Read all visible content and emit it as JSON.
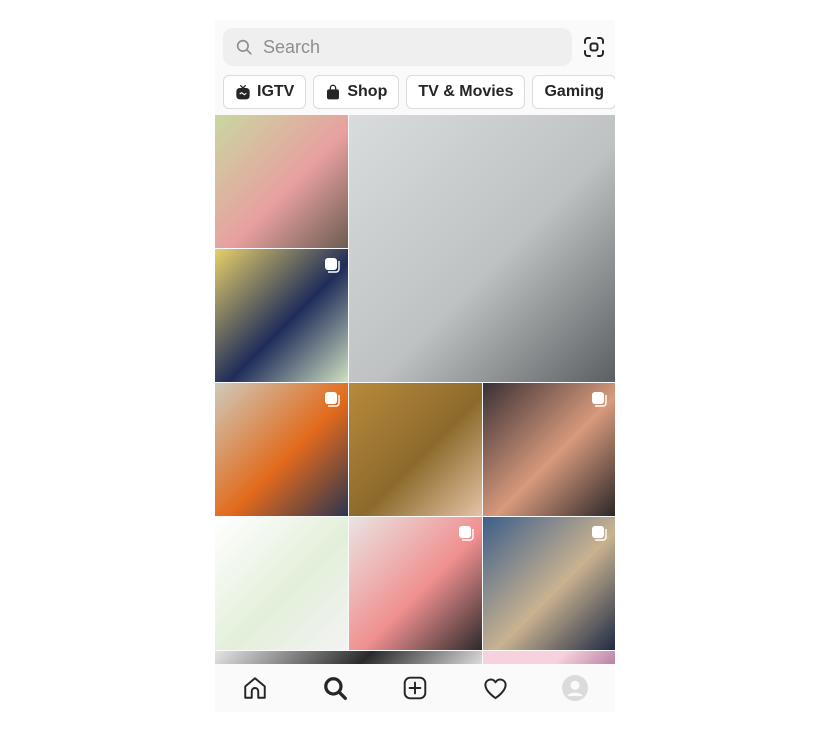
{
  "search": {
    "placeholder": "Search",
    "value": ""
  },
  "icons": {
    "search": "search-icon",
    "scan": "scan-icon",
    "igtv": "igtv-icon",
    "shop": "shopping-bag-icon",
    "home": "home-icon",
    "explore": "search-icon",
    "new_post": "plus-square-icon",
    "activity": "heart-icon",
    "profile": "avatar-icon",
    "carousel": "multiple-posts-icon"
  },
  "categories": [
    {
      "label": "IGTV",
      "icon": "igtv-icon"
    },
    {
      "label": "Shop",
      "icon": "shopping-bag-icon"
    },
    {
      "label": "TV & Movies",
      "icon": ""
    },
    {
      "label": "Gaming",
      "icon": ""
    },
    {
      "label": "",
      "icon": ""
    }
  ],
  "grid": {
    "tiles": [
      {
        "name": "anime-girl-blossoms-post",
        "carousel": false,
        "colors": [
          "#c9d7a0",
          "#e8a0a0",
          "#6b5d52"
        ]
      },
      {
        "name": "eye-drawing-video-post",
        "carousel": false,
        "colors": [
          "#d9dcdc",
          "#bfc2c2",
          "#5a5f62"
        ]
      },
      {
        "name": "embroidery-hoop-post",
        "carousel": true,
        "colors": [
          "#e7d06a",
          "#1f2c5a",
          "#cfe0c0"
        ]
      },
      {
        "name": "umbrella-car-post",
        "carousel": true,
        "colors": [
          "#cfc9bb",
          "#e26a1c",
          "#2c3550"
        ]
      },
      {
        "name": "hands-wheat-field-post",
        "carousel": false,
        "colors": [
          "#b88a3c",
          "#8c6a2c",
          "#e5c2a5"
        ]
      },
      {
        "name": "group-selfie-post",
        "carousel": true,
        "colors": [
          "#3a3035",
          "#d79a7c",
          "#2b2628"
        ]
      },
      {
        "name": "qa-screenshot-post",
        "carousel": false,
        "colors": [
          "#ffffff",
          "#e3efda",
          "#f3f3f3"
        ]
      },
      {
        "name": "face-drawing-post",
        "carousel": true,
        "colors": [
          "#e9e4e2",
          "#f08f8f",
          "#2c2a2b"
        ]
      },
      {
        "name": "anime-painting-post",
        "carousel": true,
        "colors": [
          "#3d5e8a",
          "#c9b290",
          "#1e2a45"
        ]
      },
      {
        "name": "bw-photo-post",
        "carousel": false,
        "colors": [
          "#e5e5e5",
          "#2a2a2a",
          "#e5e5e5"
        ]
      },
      {
        "name": "pink-post",
        "carousel": false,
        "colors": [
          "#f7d1dc",
          "#f7d1dc",
          "#b07aa0"
        ]
      }
    ]
  },
  "nav": [
    {
      "name": "home",
      "label": "Home"
    },
    {
      "name": "explore",
      "label": "Search"
    },
    {
      "name": "new-post",
      "label": "New Post"
    },
    {
      "name": "activity",
      "label": "Activity"
    },
    {
      "name": "profile",
      "label": "Profile"
    }
  ]
}
